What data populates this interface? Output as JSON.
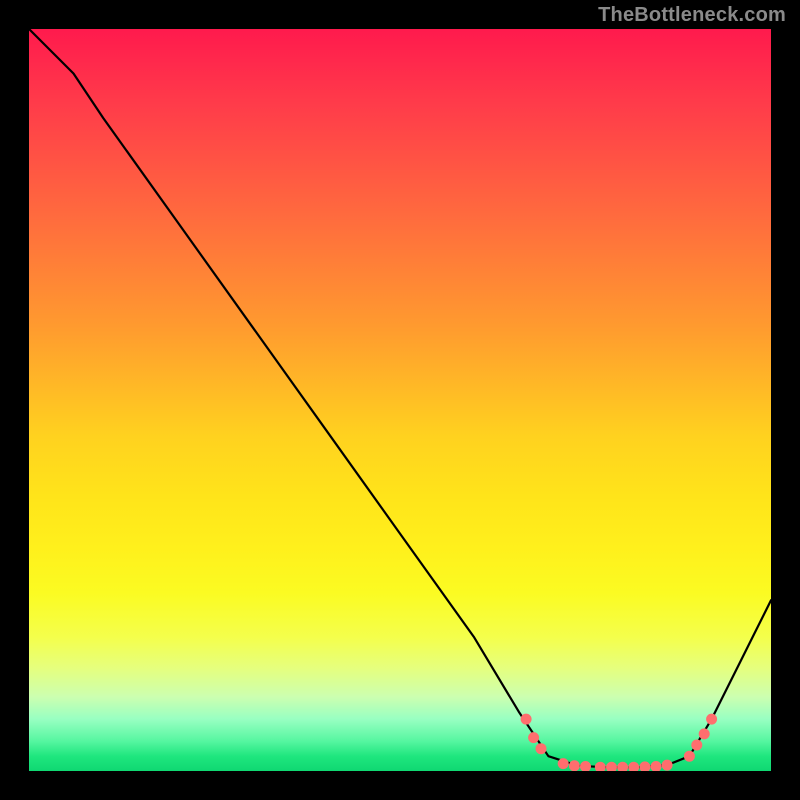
{
  "attribution": "TheBottleneck.com",
  "chart_data": {
    "type": "line",
    "title": "",
    "xlabel": "",
    "ylabel": "",
    "xlim": [
      0,
      100
    ],
    "ylim": [
      0,
      100
    ],
    "curve": [
      {
        "x": 0,
        "y": 100
      },
      {
        "x": 6,
        "y": 94
      },
      {
        "x": 10,
        "y": 88
      },
      {
        "x": 20,
        "y": 74
      },
      {
        "x": 30,
        "y": 60
      },
      {
        "x": 40,
        "y": 46
      },
      {
        "x": 50,
        "y": 32
      },
      {
        "x": 60,
        "y": 18
      },
      {
        "x": 66,
        "y": 8
      },
      {
        "x": 70,
        "y": 2
      },
      {
        "x": 74,
        "y": 0.7
      },
      {
        "x": 78,
        "y": 0.5
      },
      {
        "x": 82,
        "y": 0.5
      },
      {
        "x": 86,
        "y": 0.8
      },
      {
        "x": 89,
        "y": 2
      },
      {
        "x": 92,
        "y": 7
      },
      {
        "x": 96,
        "y": 15
      },
      {
        "x": 100,
        "y": 23
      }
    ],
    "markers": [
      {
        "x": 67,
        "y": 7
      },
      {
        "x": 68,
        "y": 4.5
      },
      {
        "x": 69,
        "y": 3
      },
      {
        "x": 72,
        "y": 1
      },
      {
        "x": 73.5,
        "y": 0.7
      },
      {
        "x": 75,
        "y": 0.6
      },
      {
        "x": 77,
        "y": 0.5
      },
      {
        "x": 78.5,
        "y": 0.5
      },
      {
        "x": 80,
        "y": 0.5
      },
      {
        "x": 81.5,
        "y": 0.5
      },
      {
        "x": 83,
        "y": 0.55
      },
      {
        "x": 84.5,
        "y": 0.6
      },
      {
        "x": 86,
        "y": 0.8
      },
      {
        "x": 89,
        "y": 2
      },
      {
        "x": 90,
        "y": 3.5
      },
      {
        "x": 91,
        "y": 5
      },
      {
        "x": 92,
        "y": 7
      }
    ],
    "marker_color": "#ff6e6e",
    "marker_radius": 5
  }
}
